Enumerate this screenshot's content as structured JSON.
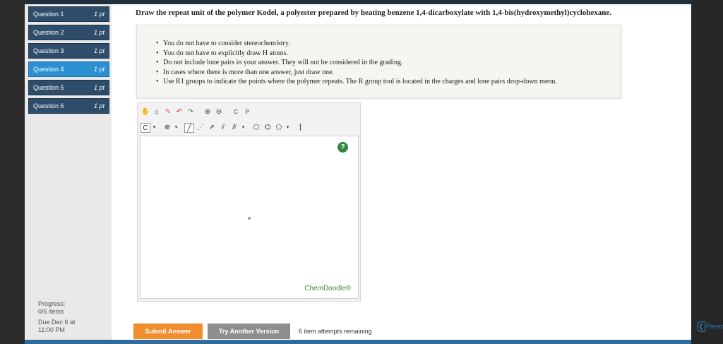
{
  "questions": [
    {
      "label": "Question 1",
      "points": "1 pt"
    },
    {
      "label": "Question 2",
      "points": "1 pt"
    },
    {
      "label": "Question 3",
      "points": "1 pt"
    },
    {
      "label": "Question 4",
      "points": "1 pt",
      "active": true
    },
    {
      "label": "Question 5",
      "points": "1 pt"
    },
    {
      "label": "Question 6",
      "points": "1 pt"
    }
  ],
  "progress": {
    "label": "Progress:",
    "value": "0/6 items",
    "due_line1": "Due Dec 6 at",
    "due_line2": "11:00 PM"
  },
  "question_text": "Draw the repeat unit of the polymer Kodel, a polyester prepared by heating benzene 1,4-dicarboxylate with 1,4-bis(hydroxymethyl)cyclohexane.",
  "instructions": [
    "You do not have to consider stereochemistry.",
    "You do not have to explicitly draw H atoms.",
    "Do not include lone pairs in your answer. They will not be considered in the grading.",
    "In cases where there is more than one answer, just draw one.",
    "Use R1 groups to indicate the points where the polymer repeats. The R group tool is located in the charges and lone pairs drop-down menu."
  ],
  "editor": {
    "element_select": "C",
    "help": "?",
    "brand": "ChemDoodle®",
    "toolbar_small_c": "C",
    "toolbar_small_p": "P"
  },
  "buttons": {
    "submit": "Submit Answer",
    "try_another": "Try Another Version"
  },
  "attempts_text": "6 item attempts remaining",
  "nav": {
    "previous": "Previo"
  },
  "colors": {
    "question_bg": "#2e4d6b",
    "question_active": "#2b8fd1",
    "submit": "#f08d2c",
    "try_another": "#8e8e8e",
    "chemdoodle_green": "#2f8a3f"
  }
}
